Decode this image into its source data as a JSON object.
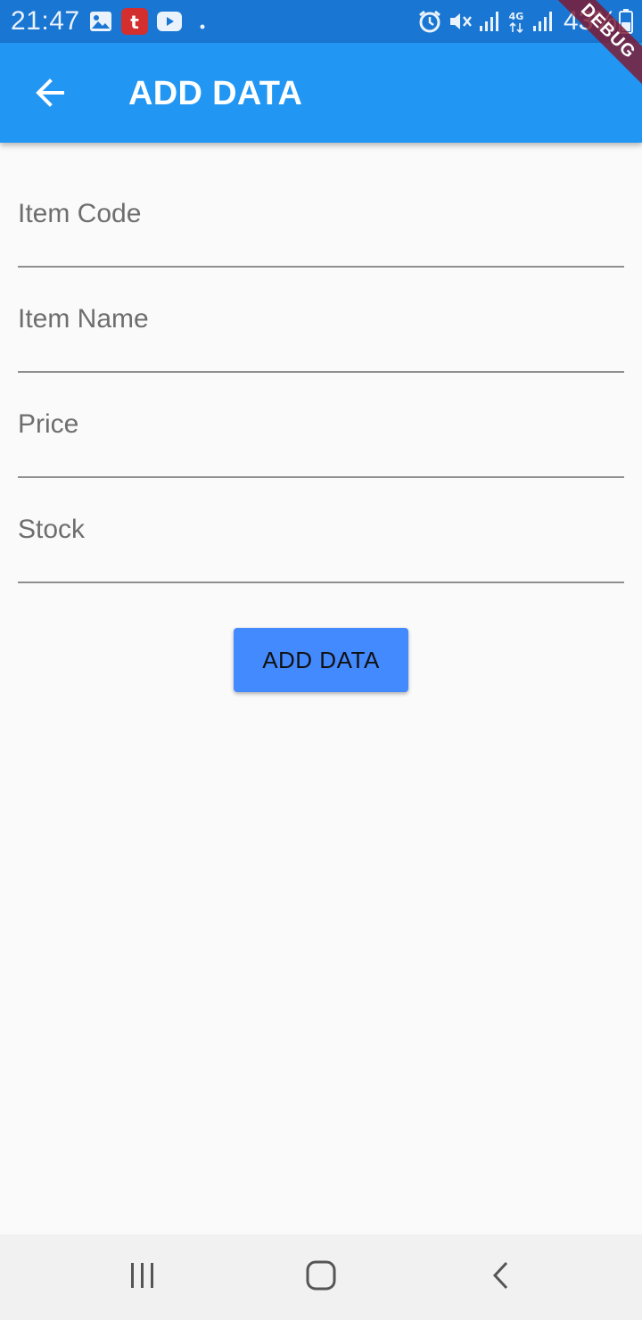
{
  "status_bar": {
    "time": "21:47",
    "battery": "43%",
    "left_icons": [
      "gallery-icon",
      "telkomsel-icon",
      "youtube-icon",
      "dot-icon"
    ],
    "right_icons": [
      "alarm-icon",
      "mute-icon",
      "signal-icon",
      "4g-icon",
      "signal-icon",
      "battery-icon"
    ]
  },
  "app_bar": {
    "title": "ADD DATA",
    "back_icon": "arrow-back-icon",
    "color": "#2196f3"
  },
  "debug_banner": "DEBUG",
  "form": {
    "fields": [
      {
        "label": "Item Code",
        "value": ""
      },
      {
        "label": "Item Name",
        "value": ""
      },
      {
        "label": "Price",
        "value": ""
      },
      {
        "label": "Stock",
        "value": ""
      }
    ],
    "submit_label": "ADD DATA",
    "submit_color": "#448aff"
  },
  "nav_bar": {
    "buttons": [
      "recents-icon",
      "home-icon",
      "back-icon"
    ]
  }
}
